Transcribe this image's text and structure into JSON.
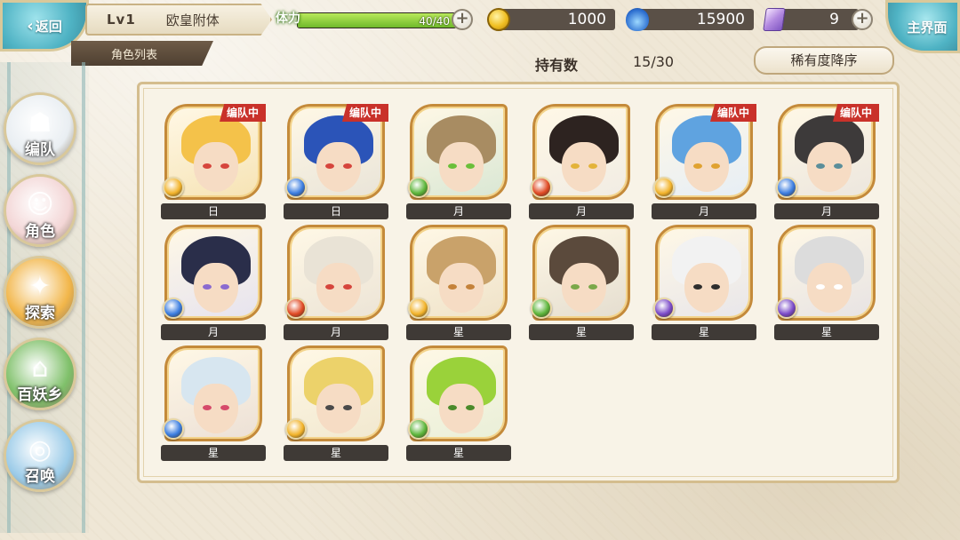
{
  "header": {
    "back_label": "返回",
    "level": "Lv1",
    "player_name": "欧皇附体",
    "list_tab": "角色列表",
    "stamina": {
      "label": "体力",
      "value": "40/40",
      "fraction": 1.0
    },
    "coins": "1000",
    "souls": "15900",
    "gems": "9",
    "main_menu_label": "主界面",
    "hold_label": "持有数",
    "hold_value": "15/30",
    "sort_label": "稀有度降序"
  },
  "nav": [
    {
      "label": "编队",
      "icon": "team-icon",
      "color": "#e9eef2"
    },
    {
      "label": "角色",
      "icon": "character-icon",
      "color": "#f3d6d6"
    },
    {
      "label": "探索",
      "icon": "explore-icon",
      "color": "#f2b64a"
    },
    {
      "label": "百妖乡",
      "icon": "village-icon",
      "color": "#7fc06a"
    },
    {
      "label": "召唤",
      "icon": "summon-icon",
      "color": "#9bcbe8"
    }
  ],
  "team_tag": "编队中",
  "characters": [
    {
      "rank": "日",
      "in_team": true,
      "element": "light",
      "hair": "#f4c24a",
      "eye": "#d6453c",
      "bg": "#f6e3b4"
    },
    {
      "rank": "日",
      "in_team": true,
      "element": "water",
      "hair": "#2b54b8",
      "eye": "#d6453c",
      "bg": "#e9e4d8"
    },
    {
      "rank": "月",
      "in_team": false,
      "element": "wind",
      "hair": "#a88c62",
      "eye": "#6abf3a",
      "bg": "#d9e7d4"
    },
    {
      "rank": "月",
      "in_team": false,
      "element": "fire",
      "hair": "#2d2320",
      "eye": "#e3b33a",
      "bg": "#f1ece4"
    },
    {
      "rank": "月",
      "in_team": true,
      "element": "light",
      "hair": "#5fa3e0",
      "eye": "#e0a230",
      "bg": "#e6eef6"
    },
    {
      "rank": "月",
      "in_team": true,
      "element": "water",
      "hair": "#3d3a3a",
      "eye": "#5a8e9a",
      "bg": "#ece6de"
    },
    {
      "rank": "月",
      "in_team": false,
      "element": "water",
      "hair": "#2a2e4a",
      "eye": "#8a6ad0",
      "bg": "#e6e3ef"
    },
    {
      "rank": "月",
      "in_team": false,
      "element": "fire",
      "hair": "#e9e3d6",
      "eye": "#d6453c",
      "bg": "#ece4d6"
    },
    {
      "rank": "星",
      "in_team": false,
      "element": "light",
      "hair": "#c9a26a",
      "eye": "#c4823a",
      "bg": "#efe2c8"
    },
    {
      "rank": "星",
      "in_team": false,
      "element": "wind",
      "hair": "#5b4a3c",
      "eye": "#7aa84a",
      "bg": "#e4ddcf"
    },
    {
      "rank": "星",
      "in_team": false,
      "element": "dark",
      "hair": "#f2f2f2",
      "eye": "#2e2e2e",
      "bg": "#e8e6ea"
    },
    {
      "rank": "星",
      "in_team": false,
      "element": "dark",
      "hair": "#dcdcdc",
      "eye": "#ffffff",
      "bg": "#e7e3e3"
    },
    {
      "rank": "星",
      "in_team": false,
      "element": "water",
      "hair": "#d7e6f0",
      "eye": "#d64a6a",
      "bg": "#ece0d6"
    },
    {
      "rank": "星",
      "in_team": false,
      "element": "light",
      "hair": "#ecd26a",
      "eye": "#4a4a4a",
      "bg": "#f1e8cf"
    },
    {
      "rank": "星",
      "in_team": false,
      "element": "wind",
      "hair": "#9ad23a",
      "eye": "#4a8a2a",
      "bg": "#e9efd8"
    }
  ],
  "element_colors": {
    "light": "#f2b32a",
    "water": "#3b7de0",
    "wind": "#5cb53a",
    "fire": "#e04a24",
    "dark": "#7a4ac8"
  }
}
